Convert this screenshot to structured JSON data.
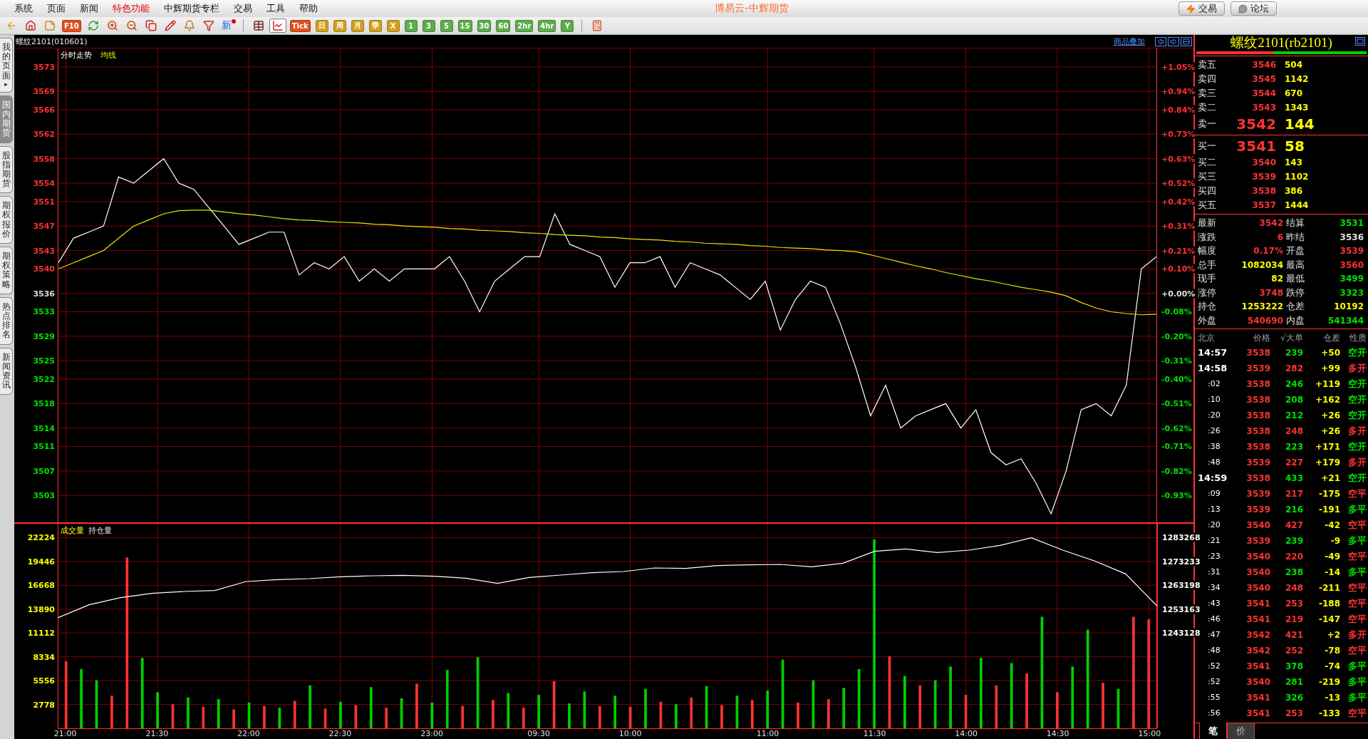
{
  "menu": {
    "items": [
      {
        "label": "系统",
        "highlight": false
      },
      {
        "label": "页面",
        "highlight": false
      },
      {
        "label": "新闻",
        "highlight": false
      },
      {
        "label": "特色功能",
        "highlight": true
      },
      {
        "label": "中辉期货专栏",
        "highlight": false
      },
      {
        "label": "交易",
        "highlight": false
      },
      {
        "label": "工具",
        "highlight": false
      },
      {
        "label": "帮助",
        "highlight": false
      }
    ],
    "title": "博易云-中辉期货",
    "buttons": [
      {
        "kind": "trade",
        "label": "交易"
      },
      {
        "kind": "forum",
        "label": "论坛"
      }
    ]
  },
  "toolbar": {
    "groups": [
      [
        {
          "kind": "back",
          "selected": false
        },
        {
          "kind": "home",
          "selected": false
        },
        {
          "kind": "notes",
          "selected": false
        },
        {
          "kind": "text",
          "label": "F10",
          "color": "#e05020",
          "selected": false
        },
        {
          "kind": "refresh",
          "selected": false
        },
        {
          "kind": "zoom-in",
          "selected": false
        },
        {
          "kind": "zoom-out",
          "selected": false
        },
        {
          "kind": "windows",
          "selected": false
        },
        {
          "kind": "pen",
          "selected": false
        },
        {
          "kind": "bell",
          "selected": false
        },
        {
          "kind": "filter",
          "selected": false
        },
        {
          "kind": "new",
          "label": "新",
          "selected": false
        }
      ],
      [
        {
          "kind": "table",
          "selected": false
        },
        {
          "kind": "chart",
          "selected": true
        },
        {
          "kind": "text",
          "label": "Tick",
          "color": "#e05020",
          "selected": false
        },
        {
          "kind": "text",
          "label": "日",
          "color": "#d4a020",
          "selected": false
        },
        {
          "kind": "text",
          "label": "周",
          "color": "#d4a020",
          "selected": false
        },
        {
          "kind": "text",
          "label": "月",
          "color": "#d4a020",
          "selected": false
        },
        {
          "kind": "text",
          "label": "季",
          "color": "#d4a020",
          "selected": false
        },
        {
          "kind": "text",
          "label": "X",
          "color": "#d4a020",
          "selected": false
        },
        {
          "kind": "text",
          "label": "1",
          "color": "#5cae4a",
          "selected": false
        },
        {
          "kind": "text",
          "label": "3",
          "color": "#5cae4a",
          "selected": false
        },
        {
          "kind": "text",
          "label": "5",
          "color": "#5cae4a",
          "selected": false
        },
        {
          "kind": "text",
          "label": "15",
          "color": "#5cae4a",
          "selected": false
        },
        {
          "kind": "text",
          "label": "30",
          "color": "#5cae4a",
          "selected": false
        },
        {
          "kind": "text",
          "label": "60",
          "color": "#5cae4a",
          "selected": false
        },
        {
          "kind": "text",
          "label": "2hr",
          "color": "#5cae4a",
          "selected": false
        },
        {
          "kind": "text",
          "label": "4hr",
          "color": "#5cae4a",
          "selected": false
        },
        {
          "kind": "text",
          "label": "Y",
          "color": "#5cae4a",
          "selected": false
        }
      ],
      [
        {
          "kind": "calculator",
          "selected": false
        }
      ]
    ]
  },
  "sidebar": {
    "tabs": [
      {
        "label": "我的页面",
        "arrow": "▸",
        "selected": false
      },
      {
        "label": "国内期货",
        "selected": true
      },
      {
        "label": "股指期货",
        "selected": false
      },
      {
        "label": "期权报价",
        "selected": false
      },
      {
        "label": "期权策略",
        "selected": false
      },
      {
        "label": "热点排名",
        "selected": false
      },
      {
        "label": "新闻资讯",
        "selected": false
      }
    ]
  },
  "chart_header": {
    "instrument": "螺纹2101(010601)",
    "overlay_link": "商品叠加"
  },
  "price_chart": {
    "chart_data": {
      "type": "line",
      "ylim": [
        3498.6,
        3576
      ],
      "yticks": [
        3573,
        3569,
        3566,
        3562,
        3558,
        3554,
        3551,
        3547,
        3543,
        3540,
        3536,
        3533,
        3529,
        3525,
        3522,
        3518,
        3514,
        3511,
        3507,
        3503
      ],
      "grid": true,
      "series": [
        {
          "name": "分时走势",
          "color": "#ffffff",
          "values": [
            3541,
            3545,
            3546,
            3547,
            3555,
            3554,
            3556,
            3558,
            3554,
            3553,
            3550,
            3547,
            3544,
            3545,
            3546,
            3546,
            3539,
            3541,
            3540,
            3542,
            3538,
            3540,
            3538,
            3540,
            3540,
            3540,
            3542,
            3538,
            3533,
            3538,
            3540,
            3542,
            3542,
            3549,
            3544,
            3543,
            3542,
            3537,
            3541,
            3541,
            3542,
            3537,
            3541,
            3540,
            3539,
            3537,
            3535,
            3538,
            3530,
            3535,
            3538,
            3537,
            3531,
            3524,
            3516,
            3521,
            3514,
            3516,
            3517,
            3518,
            3514,
            3517,
            3510,
            3508,
            3509,
            3505,
            3500,
            3507,
            3517,
            3518,
            3516,
            3521,
            3540,
            3542
          ]
        },
        {
          "name": "均线",
          "color": "#e8e800",
          "values": [
            3540,
            3541,
            3542,
            3543,
            3545,
            3547,
            3548,
            3549,
            3549.5,
            3549.6,
            3549.6,
            3549.3,
            3549,
            3548.8,
            3548.5,
            3548.2,
            3548,
            3547.9,
            3547.7,
            3547.6,
            3547.5,
            3547.3,
            3547.2,
            3547,
            3546.9,
            3546.8,
            3546.6,
            3546.5,
            3546.3,
            3546.2,
            3546.1,
            3545.9,
            3545.8,
            3545.6,
            3545.5,
            3545.4,
            3545.2,
            3545.1,
            3544.9,
            3544.8,
            3544.7,
            3544.5,
            3544.4,
            3544.2,
            3544.1,
            3544,
            3543.8,
            3543.7,
            3543.5,
            3543.4,
            3543.3,
            3543.1,
            3543,
            3542.8,
            3542.3,
            3541.7,
            3541.1,
            3540.5,
            3540,
            3539.4,
            3538.9,
            3538.4,
            3538,
            3537.5,
            3537,
            3536.6,
            3536.2,
            3535.6,
            3534.5,
            3533.6,
            3533,
            3532.7,
            3532.5,
            3532.6
          ]
        }
      ]
    },
    "percent_axis": [
      {
        "text": "+1.05%",
        "color": "#ff3232"
      },
      {
        "text": "+0.94%",
        "color": "#ff3232"
      },
      {
        "text": "+0.84%",
        "color": "#ff3232"
      },
      {
        "text": "+0.73%",
        "color": "#ff3232"
      },
      {
        "text": "+0.63%",
        "color": "#ff3232"
      },
      {
        "text": "+0.52%",
        "color": "#ff3232"
      },
      {
        "text": "+0.42%",
        "color": "#ff3232"
      },
      {
        "text": "+0.31%",
        "color": "#ff3232"
      },
      {
        "text": "+0.21%",
        "color": "#ff3232"
      },
      {
        "text": "+0.10%",
        "color": "#ff3232"
      },
      {
        "text": "+0.00%",
        "color": "#e0e0e0"
      },
      {
        "text": "-0.08%",
        "color": "#00e000"
      },
      {
        "text": "-0.20%",
        "color": "#00e000"
      },
      {
        "text": "-0.31%",
        "color": "#00e000"
      },
      {
        "text": "-0.40%",
        "color": "#00e000"
      },
      {
        "text": "-0.51%",
        "color": "#00e000"
      },
      {
        "text": "-0.62%",
        "color": "#00e000"
      },
      {
        "text": "-0.71%",
        "color": "#00e000"
      },
      {
        "text": "-0.82%",
        "color": "#00e000"
      },
      {
        "text": "-0.93%",
        "color": "#00e000"
      }
    ]
  },
  "volume_chart": {
    "chart_data": {
      "type": "bar",
      "title": "成交量",
      "grid": true,
      "ylim": [
        0,
        23836
      ],
      "yticks": [
        22224,
        19446,
        16668,
        13890,
        11112,
        8334,
        5556,
        2778
      ],
      "categories": [
        "21:00",
        null,
        null,
        null,
        null,
        null,
        "21:30",
        null,
        null,
        null,
        null,
        null,
        "22:00",
        null,
        null,
        null,
        null,
        null,
        "22:30",
        null,
        null,
        null,
        null,
        null,
        "23:00",
        null,
        null,
        null,
        null,
        null,
        null,
        "09:30",
        null,
        null,
        null,
        null,
        null,
        "10:00",
        null,
        null,
        null,
        null,
        null,
        null,
        null,
        null,
        "11:00",
        null,
        null,
        null,
        null,
        null,
        null,
        "11:30",
        null,
        null,
        null,
        null,
        null,
        "14:00",
        null,
        null,
        null,
        null,
        null,
        "14:30",
        null,
        null,
        null,
        null,
        null,
        "15:00"
      ],
      "series": [
        {
          "color": "#ff3232",
          "values": [
            7800,
            null,
            null,
            3800,
            19900,
            null,
            null,
            2800,
            null,
            2500,
            null,
            2200,
            null,
            2600,
            null,
            3200,
            null,
            2300,
            null,
            2700,
            null,
            2400,
            null,
            5200,
            null,
            null,
            2600,
            null,
            3300,
            null,
            2400,
            null,
            5500,
            null,
            null,
            2600,
            null,
            2500,
            null,
            3100,
            null,
            3600,
            null,
            2700,
            null,
            3300,
            null,
            null,
            3000,
            null,
            3400,
            null,
            null,
            null,
            8400,
            null,
            5000,
            null,
            null,
            3900,
            null,
            5000,
            null,
            6400,
            null,
            4200,
            null,
            null,
            5300,
            null,
            13000,
            12700
          ]
        },
        {
          "color": "#00d000",
          "values": [
            null,
            6900,
            5600,
            null,
            null,
            8200,
            4200,
            null,
            3600,
            null,
            3400,
            null,
            3000,
            null,
            2400,
            null,
            5000,
            null,
            3100,
            null,
            4800,
            null,
            3500,
            null,
            3000,
            6800,
            null,
            8300,
            null,
            4100,
            null,
            3900,
            null,
            2900,
            4300,
            null,
            3800,
            null,
            4600,
            null,
            2800,
            null,
            4900,
            null,
            3800,
            null,
            4400,
            8000,
            null,
            5600,
            null,
            4700,
            6900,
            22000,
            null,
            6100,
            null,
            5600,
            7200,
            null,
            8200,
            null,
            7600,
            null,
            13000,
            null,
            7200,
            11500,
            null,
            4600,
            null,
            null
          ]
        }
      ]
    }
  },
  "open_interest_chart": {
    "chart_data": {
      "type": "line",
      "title": "持仓量",
      "ylim": [
        1203000,
        1289100
      ],
      "yticks": [
        1283268,
        1273233,
        1263198,
        1253163,
        1243128
      ],
      "series": [
        {
          "color": "#ffffff",
          "values": [
            1249500,
            1255000,
            1258000,
            1259800,
            1260600,
            1261000,
            1264800,
            1265600,
            1266000,
            1266800,
            1267200,
            1267400,
            1267000,
            1266200,
            1264000,
            1266500,
            1267500,
            1268500,
            1269000,
            1270500,
            1270300,
            1271500,
            1271800,
            1272000,
            1271000,
            1272500,
            1277500,
            1278500,
            1277000,
            1278000,
            1280000,
            1283200,
            1278000,
            1273500,
            1268000,
            1254500
          ]
        }
      ]
    }
  },
  "quote": {
    "title": "螺纹2101(rb2101)",
    "ratio_bar": {
      "level": 0.45
    },
    "asks": [
      {
        "label": "卖五",
        "price": "3546",
        "volume": "504",
        "kind": "level"
      },
      {
        "label": "卖四",
        "price": "3545",
        "volume": "1142",
        "kind": "level"
      },
      {
        "label": "卖三",
        "price": "3544",
        "volume": "670",
        "kind": "level"
      },
      {
        "label": "卖二",
        "price": "3543",
        "volume": "1343",
        "kind": "level"
      },
      {
        "label": "卖一",
        "price": "3542",
        "volume": "144",
        "kind": "best"
      }
    ],
    "bids": [
      {
        "label": "买一",
        "price": "3541",
        "volume": "58",
        "kind": "best"
      },
      {
        "label": "买二",
        "price": "3540",
        "volume": "143",
        "kind": "level"
      },
      {
        "label": "买三",
        "price": "3539",
        "volume": "1102",
        "kind": "level"
      },
      {
        "label": "买四",
        "price": "3538",
        "volume": "386",
        "kind": "level"
      },
      {
        "label": "买五",
        "price": "3537",
        "volume": "1444",
        "kind": "level"
      }
    ],
    "stats": [
      {
        "label": "最新",
        "value": "3542",
        "color": "#ff3232"
      },
      {
        "label": "结算",
        "value": "3531",
        "color": "#00e000"
      },
      {
        "label": "涨跌",
        "value": "6",
        "color": "#ff3232"
      },
      {
        "label": "昨结",
        "value": "3536",
        "color": "#e0e0e0"
      },
      {
        "label": "幅度",
        "value": "0.17%",
        "color": "#ff3232"
      },
      {
        "label": "开盘",
        "value": "3539",
        "color": "#ff3232"
      },
      {
        "label": "总手",
        "value": "1082034",
        "color": "#ffff00"
      },
      {
        "label": "最高",
        "value": "3560",
        "color": "#ff3232"
      },
      {
        "label": "现手",
        "value": "82",
        "color": "#ffff00"
      },
      {
        "label": "最低",
        "value": "3499",
        "color": "#00e000"
      },
      {
        "label": "涨停",
        "value": "3748",
        "color": "#ff3232"
      },
      {
        "label": "跌停",
        "value": "3323",
        "color": "#00e000"
      },
      {
        "label": "持仓",
        "value": "1253222",
        "color": "#ffff00"
      },
      {
        "label": "仓差",
        "value": "10192",
        "color": "#ffff00"
      },
      {
        "label": "外盘",
        "value": "540690",
        "color": "#ff3232"
      },
      {
        "label": "内盘",
        "value": "541344",
        "color": "#00e000"
      }
    ]
  },
  "trades": {
    "columns": [
      "北京",
      "价格",
      "√大单",
      "仓差",
      "性质"
    ],
    "rows": [
      {
        "kind": "minute",
        "time": "14:57",
        "price": "3538",
        "volume": {
          "text": "239",
          "color": "#00e000"
        },
        "change": "+50",
        "nature": {
          "text": "空开",
          "color": "#00e000"
        }
      },
      {
        "kind": "minute",
        "time": "14:58",
        "price": "3539",
        "volume": {
          "text": "282",
          "color": "#ff3232"
        },
        "change": "+99",
        "nature": {
          "text": "多开",
          "color": "#ff3232"
        }
      },
      {
        "kind": "second",
        "time": ":02",
        "price": "3538",
        "volume": {
          "text": "246",
          "color": "#00e000"
        },
        "change": "+119",
        "nature": {
          "text": "空开",
          "color": "#00e000"
        }
      },
      {
        "kind": "second",
        "time": ":10",
        "price": "3538",
        "volume": {
          "text": "208",
          "color": "#00e000"
        },
        "change": "+162",
        "nature": {
          "text": "空开",
          "color": "#00e000"
        }
      },
      {
        "kind": "second",
        "time": ":20",
        "price": "3538",
        "volume": {
          "text": "212",
          "color": "#00e000"
        },
        "change": "+26",
        "nature": {
          "text": "空开",
          "color": "#00e000"
        }
      },
      {
        "kind": "second",
        "time": ":26",
        "price": "3538",
        "volume": {
          "text": "248",
          "color": "#ff3232"
        },
        "change": "+26",
        "nature": {
          "text": "多开",
          "color": "#ff3232"
        }
      },
      {
        "kind": "second",
        "time": ":38",
        "price": "3538",
        "volume": {
          "text": "223",
          "color": "#00e000"
        },
        "change": "+171",
        "nature": {
          "text": "空开",
          "color": "#00e000"
        }
      },
      {
        "kind": "second",
        "time": ":48",
        "price": "3539",
        "volume": {
          "text": "227",
          "color": "#ff3232"
        },
        "change": "+179",
        "nature": {
          "text": "多开",
          "color": "#ff3232"
        }
      },
      {
        "kind": "minute",
        "time": "14:59",
        "price": "3538",
        "volume": {
          "text": "433",
          "color": "#00e000"
        },
        "change": "+21",
        "nature": {
          "text": "空开",
          "color": "#00e000"
        }
      },
      {
        "kind": "second",
        "time": ":09",
        "price": "3539",
        "volume": {
          "text": "217",
          "color": "#ff3232"
        },
        "change": "-175",
        "nature": {
          "text": "空平",
          "color": "#ff3232"
        }
      },
      {
        "kind": "second",
        "time": ":13",
        "price": "3539",
        "volume": {
          "text": "216",
          "color": "#00e000"
        },
        "change": "-191",
        "nature": {
          "text": "多平",
          "color": "#00e000"
        }
      },
      {
        "kind": "second",
        "time": ":20",
        "price": "3540",
        "volume": {
          "text": "427",
          "color": "#ff3232"
        },
        "change": "-42",
        "nature": {
          "text": "空平",
          "color": "#ff3232"
        }
      },
      {
        "kind": "second",
        "time": ":21",
        "price": "3539",
        "volume": {
          "text": "239",
          "color": "#00e000"
        },
        "change": "-9",
        "nature": {
          "text": "多平",
          "color": "#00e000"
        }
      },
      {
        "kind": "second",
        "time": ":23",
        "price": "3540",
        "volume": {
          "text": "220",
          "color": "#ff3232"
        },
        "change": "-49",
        "nature": {
          "text": "空平",
          "color": "#ff3232"
        }
      },
      {
        "kind": "second",
        "time": ":31",
        "price": "3540",
        "volume": {
          "text": "238",
          "color": "#00e000"
        },
        "change": "-14",
        "nature": {
          "text": "多平",
          "color": "#00e000"
        }
      },
      {
        "kind": "second",
        "time": ":34",
        "price": "3540",
        "volume": {
          "text": "248",
          "color": "#ff3232"
        },
        "change": "-211",
        "nature": {
          "text": "空平",
          "color": "#ff3232"
        }
      },
      {
        "kind": "second",
        "time": ":43",
        "price": "3541",
        "volume": {
          "text": "253",
          "color": "#ff3232"
        },
        "change": "-188",
        "nature": {
          "text": "空平",
          "color": "#ff3232"
        }
      },
      {
        "kind": "second",
        "time": ":46",
        "price": "3541",
        "volume": {
          "text": "219",
          "color": "#ff3232"
        },
        "change": "-147",
        "nature": {
          "text": "空平",
          "color": "#ff3232"
        }
      },
      {
        "kind": "second",
        "time": ":47",
        "price": "3542",
        "volume": {
          "text": "421",
          "color": "#ff3232"
        },
        "change": "+2",
        "nature": {
          "text": "多开",
          "color": "#ff3232"
        }
      },
      {
        "kind": "second",
        "time": ":48",
        "price": "3542",
        "volume": {
          "text": "252",
          "color": "#ff3232"
        },
        "change": "-78",
        "nature": {
          "text": "空平",
          "color": "#ff3232"
        }
      },
      {
        "kind": "second",
        "time": ":52",
        "price": "3541",
        "volume": {
          "text": "378",
          "color": "#00e000"
        },
        "change": "-74",
        "nature": {
          "text": "多平",
          "color": "#00e000"
        }
      },
      {
        "kind": "second",
        "time": ":52",
        "price": "3540",
        "volume": {
          "text": "281",
          "color": "#00e000"
        },
        "change": "-219",
        "nature": {
          "text": "多平",
          "color": "#00e000"
        }
      },
      {
        "kind": "second",
        "time": ":55",
        "price": "3541",
        "volume": {
          "text": "326",
          "color": "#00e000"
        },
        "change": "-13",
        "nature": {
          "text": "多平",
          "color": "#00e000"
        }
      },
      {
        "kind": "second",
        "time": ":56",
        "price": "3541",
        "volume": {
          "text": "253",
          "color": "#ff3232"
        },
        "change": "-133",
        "nature": {
          "text": "空平",
          "color": "#ff3232"
        }
      }
    ],
    "tabs": [
      {
        "label": "笔",
        "selected": true
      },
      {
        "label": "价",
        "selected": false
      }
    ]
  }
}
